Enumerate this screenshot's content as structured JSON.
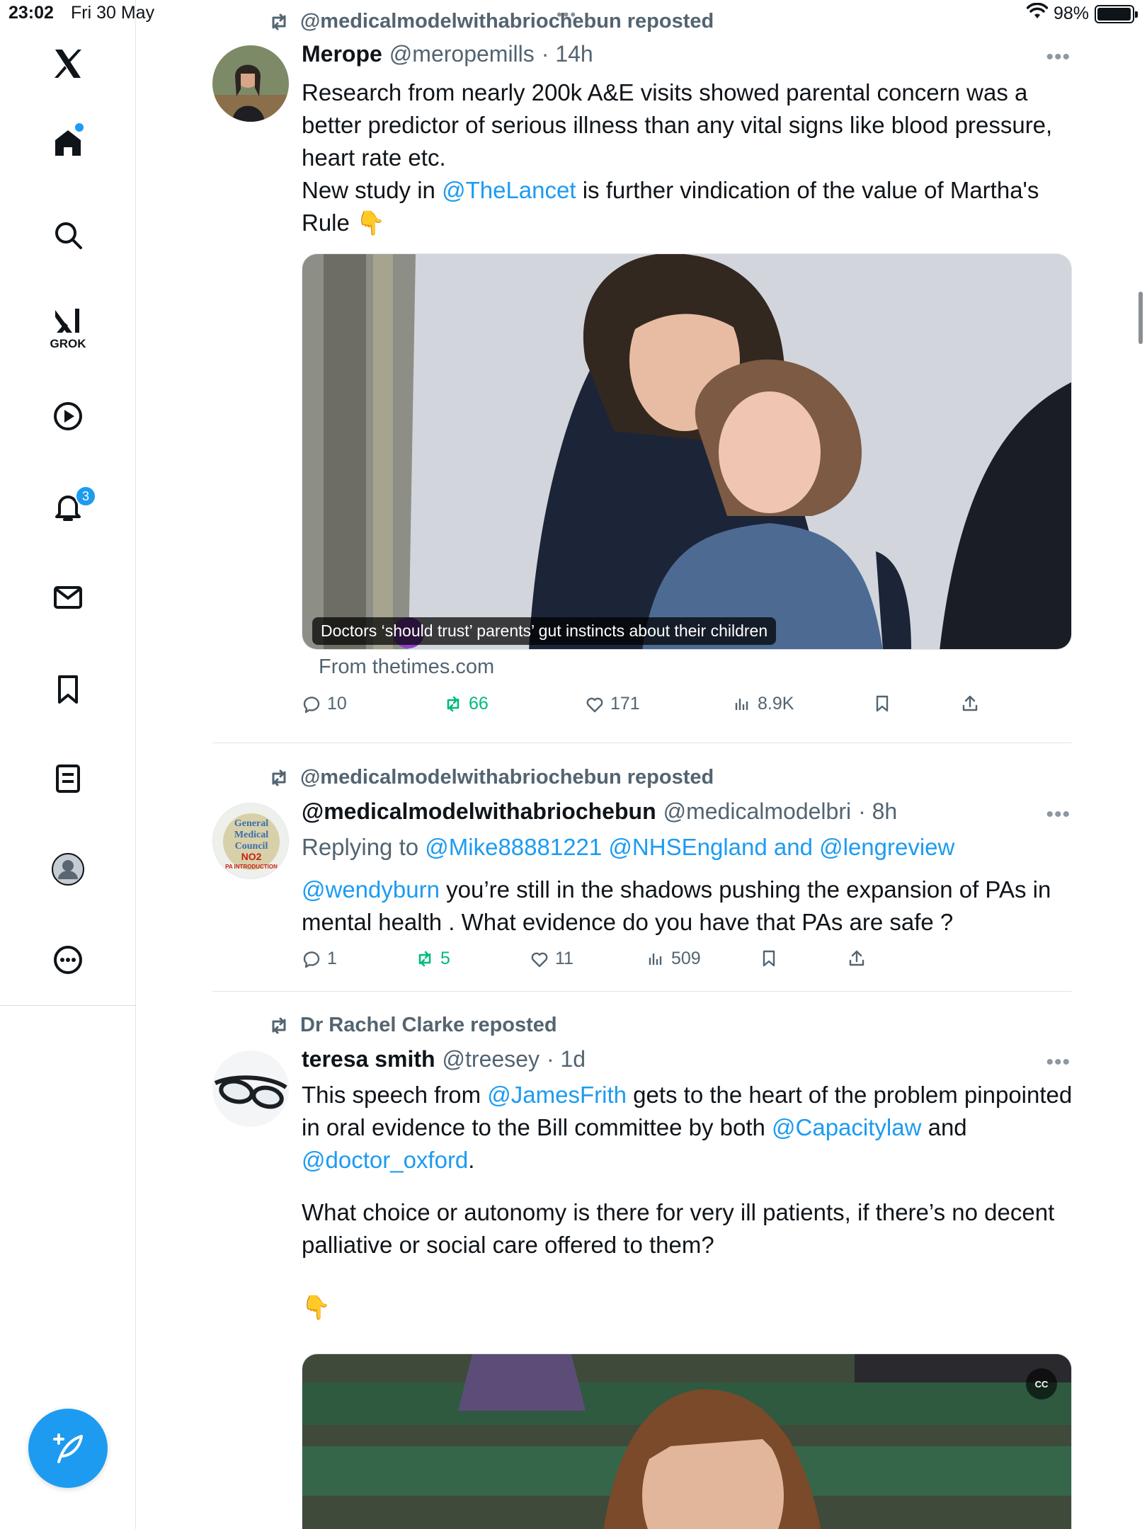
{
  "status_bar": {
    "time": "23:02",
    "date": "Fri 30 May",
    "battery": "98%",
    "battery_level": 0.98
  },
  "sidebar": {
    "grok_label": "GROK",
    "notifications_count": "3",
    "icons": [
      "x-logo-icon",
      "home-icon",
      "search-icon",
      "grok-icon",
      "video-icon",
      "bell-icon",
      "mail-icon",
      "bookmark-icon",
      "lists-icon",
      "profile-icon",
      "more-icon"
    ]
  },
  "posts": [
    {
      "repost_label": "@medicalmodelwithabriochebun reposted",
      "name": "Merope",
      "handle": "@meropemills",
      "time": "· 14h",
      "text_parts": [
        "Research from nearly 200k A&E visits showed parental concern was a better predictor of serious illness than any vital signs like blood pressure, heart rate etc.",
        "New study in ",
        "@TheLancet",
        " is further vindication of the value of Martha's Rule 👇"
      ],
      "media_caption": "Doctors ‘should trust’ parents’ gut instincts about their children",
      "link_source": "From thetimes.com",
      "replies": "10",
      "reposts": "66",
      "likes": "171",
      "views": "8.9K"
    },
    {
      "repost_label": "@medicalmodelwithabriochebun reposted",
      "name": "@medicalmodelwithabriochebun",
      "handle": "@medicalmodelbri",
      "time": "· 8h",
      "replying_prefix": "Replying to ",
      "replying_targets": "@Mike88881221 @NHSEngland and @lengreview",
      "mention": "@wendyburn",
      "text": " you’re still in the shadows pushing the expansion of PAs in mental health . What  evidence do you have that PAs are safe ?",
      "avatar_text": [
        "General",
        "Medical",
        "Council",
        "NO2",
        "PA INTRODUCTION"
      ],
      "replies": "1",
      "reposts": "5",
      "likes": "11",
      "views": "509"
    },
    {
      "repost_label": "Dr Rachel Clarke reposted",
      "name": "teresa smith",
      "handle": "@treesey",
      "time": "· 1d",
      "text_parts": [
        "This speech from ",
        "@JamesFrith",
        " gets to the heart of the problem pinpointed in oral evidence to the Bill committee by both ",
        "@Capacitylaw",
        " and ",
        "@doctor_oxford",
        ".",
        "What choice or autonomy is there for very ill patients, if there’s no decent palliative or social care offered to them?",
        "👇"
      ],
      "cc_label": "CC"
    }
  ]
}
